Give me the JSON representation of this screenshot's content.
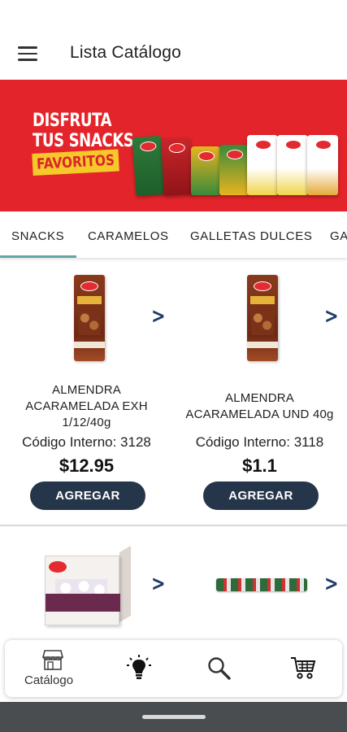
{
  "app_bar": {
    "title": "Lista Catálogo",
    "menu_icon": "hamburger-menu-icon"
  },
  "banner": {
    "line1": "DISFRUTA",
    "line2": "TUS SNACKS",
    "tag": "FAVORITOS",
    "background": "#e3252b",
    "tag_color": "#f7c82a"
  },
  "tabs": [
    {
      "label": "SNACKS"
    },
    {
      "label": "CARAMELOS"
    },
    {
      "label": "GALLETAS DULCES"
    },
    {
      "label": "GA"
    }
  ],
  "products": [
    {
      "name": "ALMENDRA ACARAMELADA EXH 1/12/40g",
      "code": "Código Interno: 3128",
      "price": "$12.95",
      "button": "AGREGAR"
    },
    {
      "name": "ALMENDRA ACARAMELADA UND 40g",
      "code": "Código Interno: 3118",
      "price": "$1.1",
      "button": "AGREGAR"
    }
  ],
  "chevron": ">",
  "bottom_nav": {
    "catalog_label": "Catálogo",
    "icons": [
      "store-icon",
      "lightbulb-icon",
      "search-icon",
      "cart-icon"
    ]
  },
  "colors": {
    "button": "#26364a",
    "accent_tab": "#63a6a6",
    "chevron": "#1f3a66"
  }
}
